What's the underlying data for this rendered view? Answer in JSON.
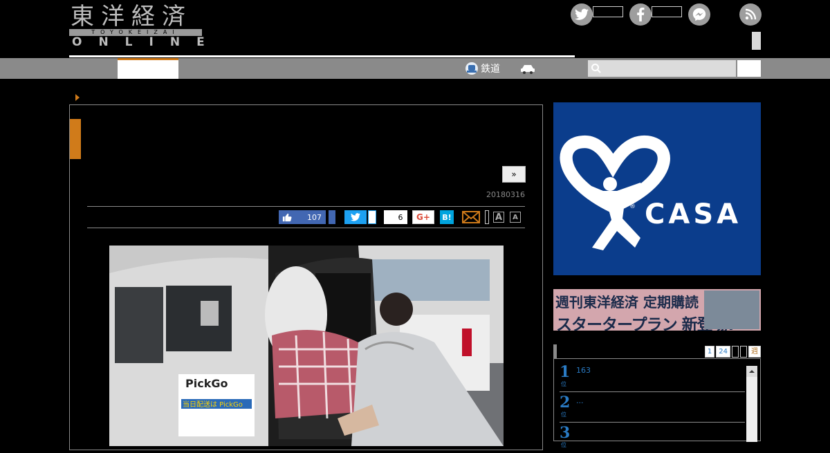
{
  "logo": {
    "kanji": "東洋経済",
    "romaji": "TOYOKEIZAI",
    "online": "ONLINE"
  },
  "nav": {
    "railway_label": "鉄道"
  },
  "search": {
    "placeholder": ""
  },
  "article": {
    "next_label": "»",
    "date": "20180316",
    "share": {
      "fb_count": "107",
      "hatena_count": "6",
      "gplus_label": "G+",
      "hatena_label": "B!"
    },
    "font_size": {
      "large": "A",
      "small": "A"
    },
    "photo_signage": {
      "brand": "PickGo",
      "line1": "当日配送は PickGo"
    }
  },
  "sidebar": {
    "casa_ad": {
      "brand": "CASA",
      "mark": "®"
    },
    "toyo_ad": {
      "line1": "週刊東洋経済 定期購読",
      "line2": "スタータープラン 新登場!"
    },
    "ranking": {
      "tabs": [
        "1",
        "24",
        "",
        "",
        "週"
      ],
      "items": [
        {
          "rank": "1",
          "unit": "位",
          "text": "163"
        },
        {
          "rank": "2",
          "unit": "位",
          "text": "..."
        },
        {
          "rank": "3",
          "unit": "位",
          "text": ""
        }
      ]
    }
  },
  "colors": {
    "accent": "#d07b1a",
    "nav": "#8a8a8a",
    "casa_blue": "#0b3d8c",
    "link_blue": "#2a7bc4"
  }
}
